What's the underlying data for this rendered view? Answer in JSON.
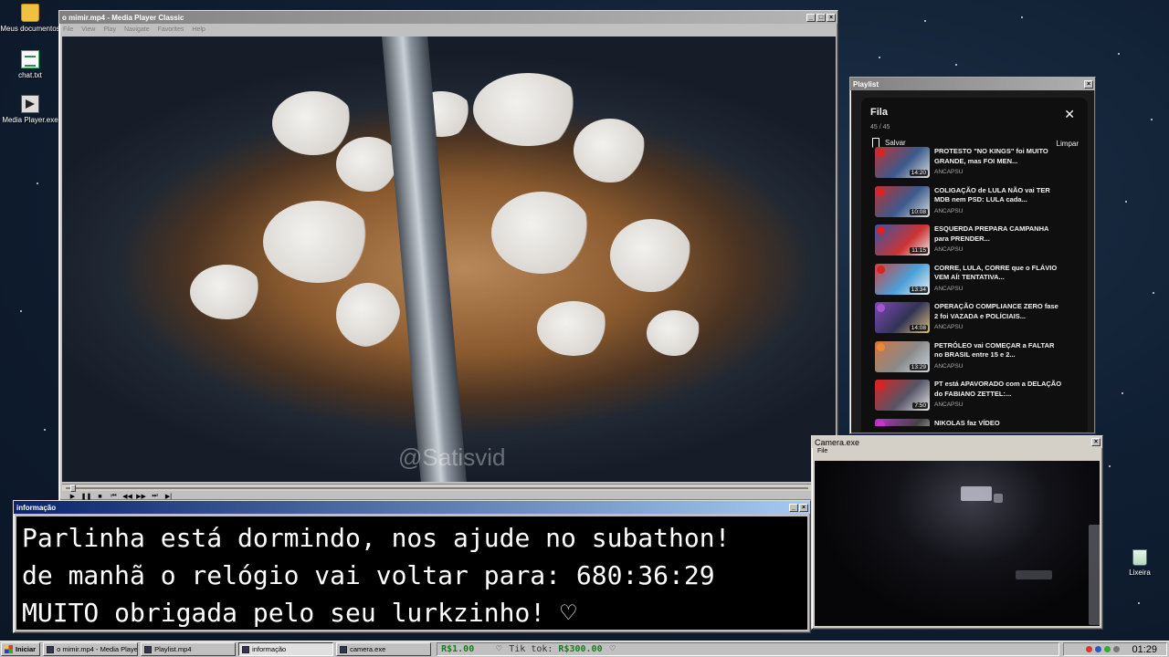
{
  "desktop": {
    "icons": [
      {
        "label": "Meus documentos",
        "icon": "folder-icon"
      },
      {
        "label": "chat.txt",
        "icon": "text-file-icon"
      },
      {
        "label": "Media Player.exe",
        "icon": "media-player-icon"
      },
      {
        "label": "Lixeira",
        "icon": "recycle-bin-icon"
      }
    ]
  },
  "media_player": {
    "title": "o mimir.mp4 - Media Player Classic",
    "menu": [
      "File",
      "View",
      "Play",
      "Navigate",
      "Favorites",
      "Help"
    ],
    "watermark": "@Satisvid",
    "playback_progress": 0.005
  },
  "playlist": {
    "window_title": "Playlist",
    "header": "Fila",
    "count": "45 / 45",
    "save_label": "Salvar",
    "clear_label": "Limpar",
    "items": [
      {
        "title": "PROTESTO \"NO KINGS\" foi MUITO GRANDE, mas FOI MEN...",
        "duration": "14:20",
        "channel": "ANCAPSU"
      },
      {
        "title": "COLIGAÇÃO de LULA NÃO vai TER MDB nem PSD: LULA cada...",
        "duration": "10:08",
        "channel": "ANCAPSU"
      },
      {
        "title": "ESQUERDA PREPARA CAMPANHA para PRENDER...",
        "duration": "11:15",
        "channel": "ANCAPSU"
      },
      {
        "title": "CORRE, LULA, CORRE que o FLÁVIO VEM AÍ! TENTATIVA...",
        "duration": "13:34",
        "channel": "ANCAPSU"
      },
      {
        "title": "OPERAÇÃO COMPLIANCE ZERO fase 2 foi VAZADA e POLÍCIAIS...",
        "duration": "14:08",
        "channel": "ANCAPSU"
      },
      {
        "title": "PETRÓLEO vai COMEÇAR a FALTAR no BRASIL entre 15 e 2...",
        "duration": "13:29",
        "channel": "ANCAPSU"
      },
      {
        "title": "PT está APAVORADO com a DELAÇÃO do FABIANO ZETTEL:...",
        "duration": "7:50",
        "channel": "ANCAPSU"
      },
      {
        "title": "NIKOLAS faz VÍDEO",
        "duration": "",
        "channel": ""
      }
    ]
  },
  "info_window": {
    "title": "informação",
    "lines": [
      "Parlinha está dormindo, nos ajude no subathon!",
      "de manhã o relógio vai voltar para:  680:36:29",
      "MUITO obrigada pelo seu lurkzinho! ♡"
    ]
  },
  "camera": {
    "title": "Camera.exe",
    "menu": "File"
  },
  "taskbar": {
    "start_label": "Iniciar",
    "tasks": [
      {
        "label": "o mimir.mp4 - Media Player..."
      },
      {
        "label": "Playlist.mp4"
      },
      {
        "label": "informação"
      },
      {
        "label": "camera.exe"
      }
    ],
    "ticker": {
      "first_amount": "R$1.00",
      "heart": "♡",
      "tiktok_label": "Tik tok:",
      "tiktok_amount": "R$300.00",
      "heart2": "♡"
    },
    "clock": "01:29"
  }
}
